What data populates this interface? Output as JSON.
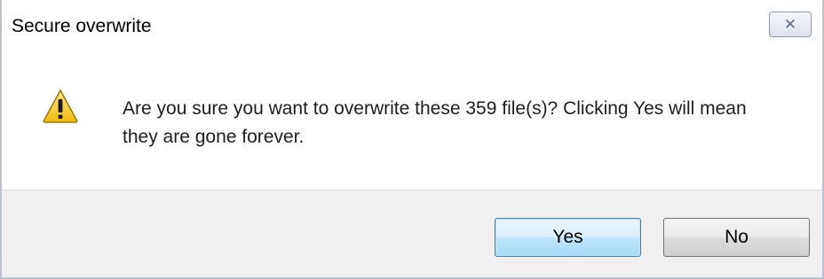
{
  "window": {
    "title": "Secure overwrite",
    "close_glyph": "✕"
  },
  "message": {
    "text": "Are you sure you want to overwrite these 359 file(s)?  Clicking Yes will mean they are gone forever.",
    "icon": "warning-icon"
  },
  "buttons": {
    "yes_label": "Yes",
    "no_label": "No"
  },
  "colors": {
    "icon_fill": "#f5c518",
    "icon_outline": "#8a6b00",
    "default_button_border": "#3c7fb1",
    "footer_background": "#f0f0f0"
  }
}
